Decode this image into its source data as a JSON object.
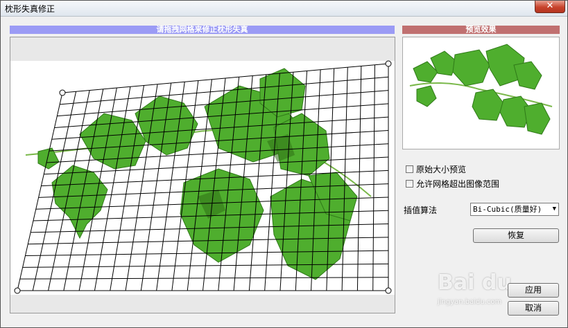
{
  "window": {
    "title": "枕形失真修正",
    "close_glyph": "✕"
  },
  "left_panel": {
    "header": "请拖拽网格来修正枕形失真"
  },
  "right_panel": {
    "header": "预览效果",
    "options": {
      "original_size_preview": "原始大小预览",
      "allow_grid_outside": "允许网格超出图像范围"
    },
    "interpolation_label": "插值算法",
    "interpolation_value": "Bi-Cubic(质量好)",
    "reset_button": "恢复",
    "apply_button": "应用",
    "cancel_button": "取消"
  },
  "watermark": {
    "brand": "Bai du",
    "sub": "jingyan.baidu.com"
  },
  "colors": {
    "left_header_bg": "#9b9bf5",
    "right_header_bg": "#c07070",
    "leaf_green": "#4fae2e"
  }
}
